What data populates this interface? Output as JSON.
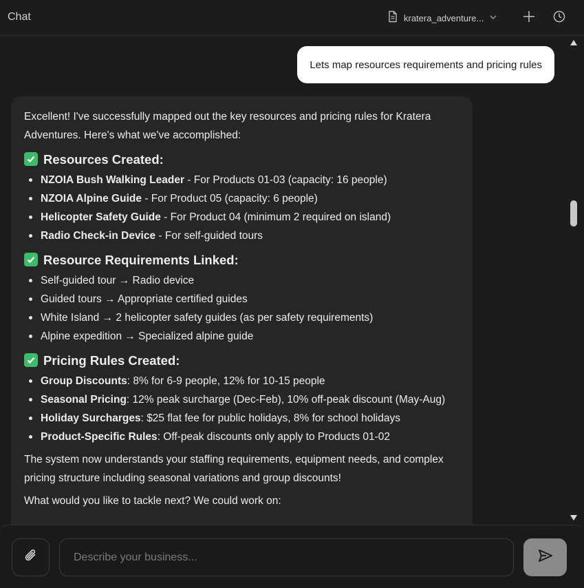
{
  "header": {
    "title": "Chat",
    "file_name": "kratera_adventure...",
    "icons": {
      "file": "document-icon",
      "dropdown": "chevron-down-icon",
      "new_chat": "plus-icon",
      "history": "clock-icon"
    }
  },
  "user_message": "Lets map resources requirements and pricing rules",
  "assistant": {
    "intro": "Excellent! I've successfully mapped out the key resources and pricing rules for Kratera Adventures. Here's what we've accomplished:",
    "sections": [
      {
        "heading": "Resources Created:",
        "items": [
          {
            "bold": "NZOIA Bush Walking Leader",
            "text": " - For Products 01-03 (capacity: 16 people)"
          },
          {
            "bold": "NZOIA Alpine Guide",
            "text": " - For Product 05 (capacity: 6 people)"
          },
          {
            "bold": "Helicopter Safety Guide",
            "text": " - For Product 04 (minimum 2 required on island)"
          },
          {
            "bold": "Radio Check-in Device",
            "text": " - For self-guided tours"
          }
        ]
      },
      {
        "heading": "Resource Requirements Linked:",
        "items": [
          {
            "bold": "",
            "text": "Self-guided tour → Radio device"
          },
          {
            "bold": "",
            "text": "Guided tours → Appropriate certified guides"
          },
          {
            "bold": "",
            "text": "White Island → 2 helicopter safety guides (as per safety requirements)"
          },
          {
            "bold": "",
            "text": "Alpine expedition → Specialized alpine guide"
          }
        ]
      },
      {
        "heading": "Pricing Rules Created:",
        "items": [
          {
            "bold": "Group Discounts",
            "text": ": 8% for 6-9 people, 12% for 10-15 people"
          },
          {
            "bold": "Seasonal Pricing",
            "text": ": 12% peak surcharge (Dec-Feb), 10% off-peak discount (May-Aug)"
          },
          {
            "bold": "Holiday Surcharges",
            "text": ": $25 flat fee for public holidays, 8% for school holidays"
          },
          {
            "bold": "Product-Specific Rules",
            "text": ": Off-peak discounts only apply to Products 01-02"
          }
        ]
      }
    ],
    "summary": "The system now understands your staffing requirements, equipment needs, and complex pricing structure including seasonal variations and group discounts!",
    "followup": "What would you like to tackle next? We could work on:"
  },
  "composer": {
    "placeholder": "Describe your business...",
    "value": "",
    "icons": {
      "attach": "paperclip-icon",
      "send": "send-icon"
    }
  },
  "colors": {
    "background": "#1c1c1c",
    "assistant_bubble": "#262626",
    "user_bubble": "#ffffff",
    "check": "#3dba6a",
    "send_button": "#8a8a8a"
  }
}
